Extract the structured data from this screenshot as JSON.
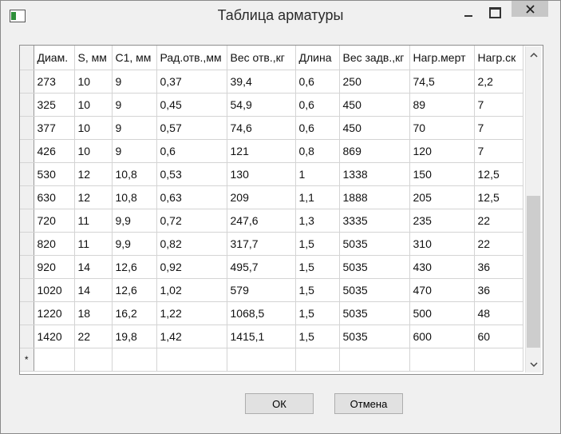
{
  "window": {
    "title": "Таблица арматуры"
  },
  "table": {
    "new_row_marker": "*",
    "columns": [
      "Диам.",
      "S, мм",
      "C1, мм",
      "Рад.отв.,мм",
      "Вес отв.,кг",
      "Длина",
      "Вес задв.,кг",
      "Нагр.мерт",
      "Нагр.ск"
    ],
    "rows": [
      [
        "273",
        "10",
        "9",
        "0,37",
        "39,4",
        "0,6",
        "250",
        "74,5",
        "2,2"
      ],
      [
        "325",
        "10",
        "9",
        "0,45",
        "54,9",
        "0,6",
        "450",
        "89",
        "7"
      ],
      [
        "377",
        "10",
        "9",
        "0,57",
        "74,6",
        "0,6",
        "450",
        "70",
        "7"
      ],
      [
        "426",
        "10",
        "9",
        "0,6",
        "121",
        "0,8",
        "869",
        "120",
        "7"
      ],
      [
        "530",
        "12",
        "10,8",
        "0,53",
        "130",
        "1",
        "1338",
        "150",
        "12,5"
      ],
      [
        "630",
        "12",
        "10,8",
        "0,63",
        "209",
        "1,1",
        "1888",
        "205",
        "12,5"
      ],
      [
        "720",
        "11",
        "9,9",
        "0,72",
        "247,6",
        "1,3",
        "3335",
        "235",
        "22"
      ],
      [
        "820",
        "11",
        "9,9",
        "0,82",
        "317,7",
        "1,5",
        "5035",
        "310",
        "22"
      ],
      [
        "920",
        "14",
        "12,6",
        "0,92",
        "495,7",
        "1,5",
        "5035",
        "430",
        "36"
      ],
      [
        "1020",
        "14",
        "12,6",
        "1,02",
        "579",
        "1,5",
        "5035",
        "470",
        "36"
      ],
      [
        "1220",
        "18",
        "16,2",
        "1,22",
        "1068,5",
        "1,5",
        "5035",
        "500",
        "48"
      ],
      [
        "1420",
        "22",
        "19,8",
        "1,42",
        "1415,1",
        "1,5",
        "5035",
        "600",
        "60"
      ]
    ]
  },
  "buttons": {
    "ok": "ОК",
    "cancel": "Отмена"
  }
}
